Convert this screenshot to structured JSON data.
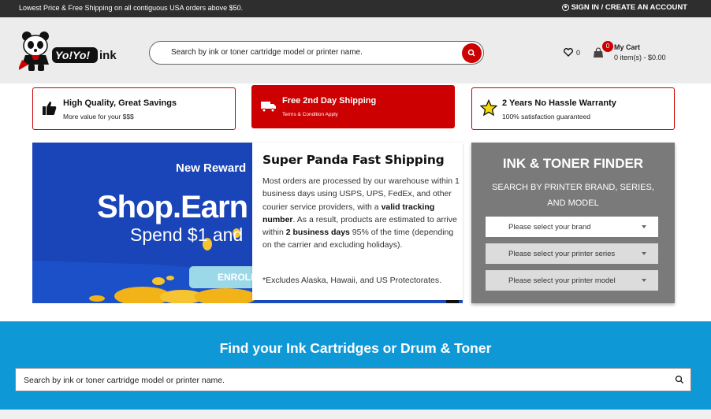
{
  "topbar": {
    "promo": "Lowest Price & Free Shipping on all contiguous USA orders above $50.",
    "account": "SIGN IN / CREATE AN ACCOUNT"
  },
  "header": {
    "logo_text": "Yo!Yo!ink",
    "search_placeholder": "Search by ink or toner cartridge model or printer name.",
    "wishlist_count": "0",
    "cart_count": "0",
    "cart_title": "My Cart",
    "cart_summary": "0 item(s) - $0.00"
  },
  "features": [
    {
      "title": "High Quality, Great Savings",
      "subtitle": "More value for your $$$"
    },
    {
      "title": "Free 2nd Day Shipping",
      "subtitle": "Terms & Condition Apply"
    },
    {
      "title": "2 Years No Hassle Warranty",
      "subtitle": "100% satisfaction guaranteed"
    }
  ],
  "banner": {
    "new_rewards": "New Reward",
    "shop_earn": "Shop.Earn",
    "spend": "Spend $1 and",
    "enroll": "ENROLL"
  },
  "popup": {
    "title": "Super Panda Fast Shipping",
    "p1_a": "Most orders are processed by our warehouse within 1 business days using USPS, UPS, FedEx, and other courier service providers, with a ",
    "p1_bold": "valid tracking number",
    "p1_b": ". As a result, products are estimated to arrive within ",
    "p1_bold2": "2 business days",
    "p1_c": " 95% of the time (depending on the carrier and excluding holidays).",
    "note": "*Excludes Alaska, Hawaii, and US Protectorates."
  },
  "finder": {
    "title": "INK & TONER FINDER",
    "subtitle": "SEARCH BY PRINTER BRAND, SERIES, AND MODEL",
    "brand": "Please select your brand",
    "series": "Please select your printer series",
    "model": "Please select your printer model"
  },
  "bottom": {
    "heading": "Find your Ink Cartridges or Drum & Toner",
    "search_placeholder": "Search by ink or toner cartridge model or printer name."
  },
  "colors": {
    "brand_red": "#cc0000",
    "finder_gray": "#7a7a7a",
    "section_blue": "#0f98d6"
  }
}
